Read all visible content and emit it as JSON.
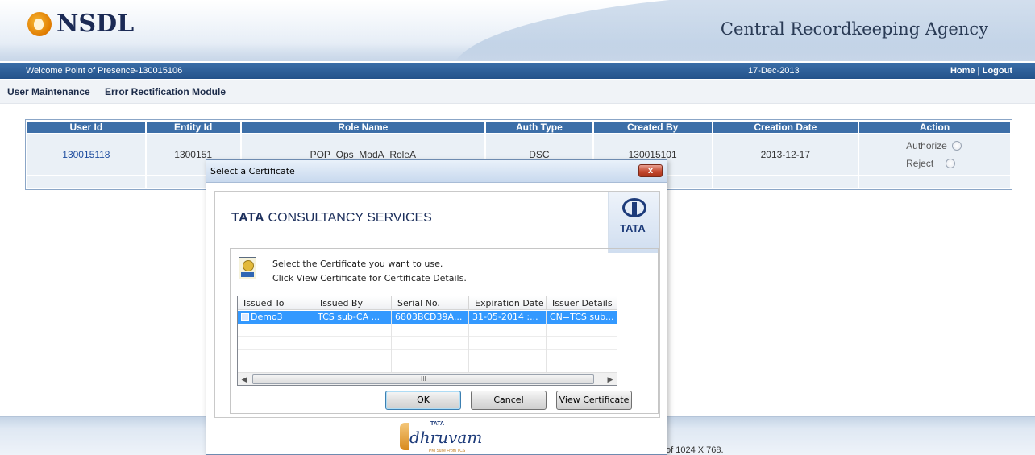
{
  "header": {
    "logo_text": "NSDL",
    "agency_title": "Central Recordkeeping Agency"
  },
  "bluebar": {
    "welcome": "Welcome Point of Presence-130015106",
    "date": "17-Dec-2013",
    "home": "Home",
    "separator": " | ",
    "logout": "Logout"
  },
  "menu": {
    "user_maintenance": "User Maintenance",
    "error_rectification": "Error Rectification Module"
  },
  "table": {
    "columns": [
      "User Id",
      "Entity Id",
      "Role Name",
      "Auth Type",
      "Created By",
      "Creation Date",
      "Action"
    ],
    "row": {
      "user_id": "130015118",
      "entity_id": "1300151",
      "role_name": "POP_Ops_ModA_RoleA",
      "auth_type": "DSC",
      "created_by": "130015101",
      "creation_date": "2013-12-17",
      "authorize_label": "Authorize",
      "reject_label": "Reject"
    }
  },
  "footer": {
    "resolution_text": "of 1024 X 768."
  },
  "dialog": {
    "title": "Select a Certificate",
    "close": "x",
    "brand_bold": "TATA",
    "brand_rest": " CONSULTANCY SERVICES",
    "badge_word": "TATA",
    "instruction_1": "Select the Certificate you want to use.",
    "instruction_2": "Click View Certificate for Certificate Details.",
    "list": {
      "columns": [
        "Issued To",
        "Issued By",
        "Serial No.",
        "Expiration Date",
        "Issuer Details"
      ],
      "rows": [
        {
          "issued_to": "Demo3",
          "issued_by": "TCS sub-CA ...",
          "serial": "6803BCD39A...",
          "expiration": "31-05-2014 :...",
          "issuer_details": "CN=TCS sub..."
        }
      ],
      "scroll_grip": "III"
    },
    "buttons": {
      "ok": "OK",
      "cancel": "Cancel",
      "view_certificate": "View Certificate"
    },
    "footer_logo": {
      "tata": "TATA",
      "name": "dhruvam",
      "tag": "PKI Suite From TCS"
    }
  }
}
